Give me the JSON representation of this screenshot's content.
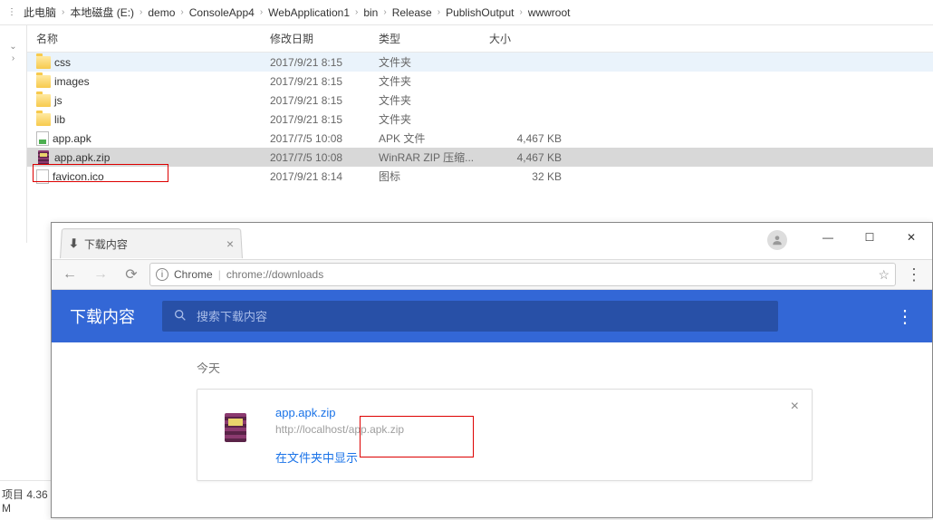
{
  "breadcrumb": [
    "此电脑",
    "本地磁盘 (E:)",
    "demo",
    "ConsoleApp4",
    "WebApplication1",
    "bin",
    "Release",
    "PublishOutput",
    "wwwroot"
  ],
  "columns": {
    "name": "名称",
    "date": "修改日期",
    "type": "类型",
    "size": "大小"
  },
  "files": [
    {
      "name": "css",
      "date": "2017/9/21 8:15",
      "type": "文件夹",
      "size": "",
      "icon": "folder"
    },
    {
      "name": "images",
      "date": "2017/9/21 8:15",
      "type": "文件夹",
      "size": "",
      "icon": "folder"
    },
    {
      "name": "js",
      "date": "2017/9/21 8:15",
      "type": "文件夹",
      "size": "",
      "icon": "folder"
    },
    {
      "name": "lib",
      "date": "2017/9/21 8:15",
      "type": "文件夹",
      "size": "",
      "icon": "folder"
    },
    {
      "name": "app.apk",
      "date": "2017/7/5 10:08",
      "type": "APK 文件",
      "size": "4,467 KB",
      "icon": "apk"
    },
    {
      "name": "app.apk.zip",
      "date": "2017/7/5 10:08",
      "type": "WinRAR ZIP 压缩...",
      "size": "4,467 KB",
      "icon": "rar",
      "selected": true
    },
    {
      "name": "favicon.ico",
      "date": "2017/9/21 8:14",
      "type": "图标",
      "size": "32 KB",
      "icon": "file"
    }
  ],
  "status": "项目  4.36 M",
  "chrome": {
    "tab_title": "下载内容",
    "omni_label": "Chrome",
    "omni_url": "chrome://downloads",
    "header_title": "下载内容",
    "search_placeholder": "搜索下载内容",
    "section": "今天",
    "item": {
      "name": "app.apk.zip",
      "url": "http://localhost/app.apk.zip",
      "action": "在文件夹中显示"
    }
  }
}
